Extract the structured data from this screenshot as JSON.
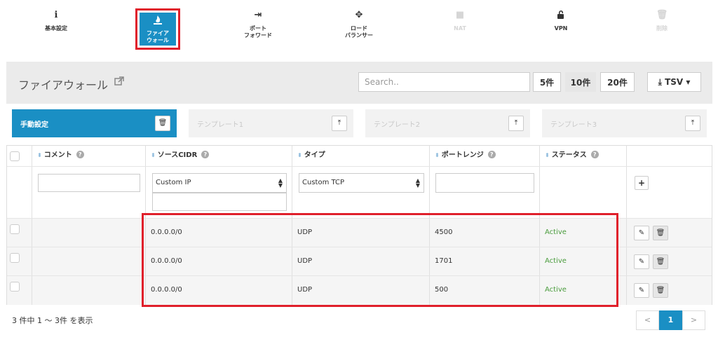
{
  "nav": {
    "items": [
      {
        "label1": "基本設定",
        "label2": "",
        "icon": "info-icon",
        "glyph": "ℹ"
      },
      {
        "label1": "ファイア",
        "label2": "ウォール",
        "icon": "firewall-icon",
        "glyph": "🔥"
      },
      {
        "label1": "ポート",
        "label2": "フォワード",
        "icon": "sign-in-icon",
        "glyph": "⇥"
      },
      {
        "label1": "ロード",
        "label2": "バランサー",
        "icon": "arrows-icon",
        "glyph": "✥"
      },
      {
        "label1": "NAT",
        "label2": "",
        "icon": "nat-icon",
        "glyph": "■"
      },
      {
        "label1": "VPN",
        "label2": "",
        "icon": "unlock-icon",
        "glyph": "🔓"
      },
      {
        "label1": "削除",
        "label2": "",
        "icon": "trash-icon",
        "glyph": "🗑"
      }
    ],
    "active_index": 1
  },
  "header": {
    "title": "ファイアウォール",
    "search_placeholder": "Search..",
    "page_sizes": [
      "5件",
      "10件",
      "20件"
    ],
    "selected_page_size": "10件",
    "export_label": "TSV",
    "export_caret": "▾",
    "export_glyph": "⤓"
  },
  "templates": [
    {
      "label": "手動設定",
      "action_glyph": "🗑",
      "action_icon": "trash-icon"
    },
    {
      "label": "テンプレート1",
      "action_glyph": "⤒",
      "action_icon": "upload-icon"
    },
    {
      "label": "テンプレート2",
      "action_glyph": "⤒",
      "action_icon": "upload-icon"
    },
    {
      "label": "テンプレート3",
      "action_glyph": "⤒",
      "action_icon": "upload-icon"
    }
  ],
  "table": {
    "sort_glyph": "⬍",
    "help_glyph": "?",
    "columns": [
      "コメント",
      "ソースCIDR",
      "タイプ",
      "ポートレンジ",
      "ステータス"
    ],
    "filter": {
      "comment_value": "",
      "cidr_select": "Custom IP",
      "cidr_value": "",
      "type_select": "Custom TCP",
      "port_value": "",
      "add_glyph": "+"
    },
    "rows": [
      {
        "comment": "",
        "cidr": "0.0.0.0/0",
        "type": "UDP",
        "port": "4500",
        "status": "Active"
      },
      {
        "comment": "",
        "cidr": "0.0.0.0/0",
        "type": "UDP",
        "port": "1701",
        "status": "Active"
      },
      {
        "comment": "",
        "cidr": "0.0.0.0/0",
        "type": "UDP",
        "port": "500",
        "status": "Active"
      }
    ],
    "edit_glyph": "✎",
    "delete_glyph": "🗑"
  },
  "footer": {
    "summary": "3 件中 1 〜 3件 を表示",
    "prev": "<",
    "current": "1",
    "next": ">"
  },
  "colors": {
    "accent": "#1a8fc4",
    "highlight": "#e0202b",
    "status_active": "#4a9c3d"
  }
}
